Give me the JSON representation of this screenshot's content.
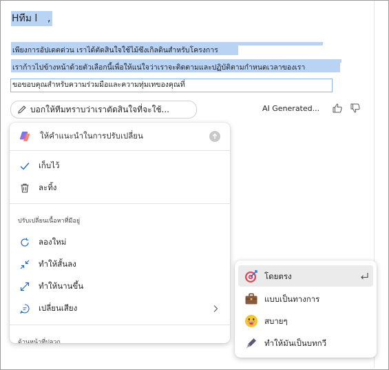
{
  "document": {
    "greeting_name": "Hทีม l",
    "greeting_comma": ",",
    "lines": [
      "เพียงการอัปเดตด่วน เราได้ตัดสินใจใช้ไม้ซึงเกิลดินสำหรับโครงการ",
      "เราก้าวไปข้างหน้าด้วยตัวเลือกนี้เพื่อให้แน่ใจว่าเราจะติดตามและปฏิบัติตามกำหนดเวลาของเรา",
      "ขอขอบคุณสำหรับความร่วมมือและความทุ่มเทของคุณที่"
    ]
  },
  "prompt_bar": {
    "placeholder": "บอกให้ทีมทราบว่าเราตัดสินใจที่จะใช้...",
    "ai_generated": "AI Generated...",
    "icons": {
      "edit": "pencil-icon",
      "like": "thumbs-up-icon",
      "dislike": "thumbs-down-icon"
    }
  },
  "menu": {
    "input_placeholder": "ให้คำแนะนำในการปรับเปลี่ยน",
    "keep": "เก็บไว้",
    "discard": "ละทิ้ง",
    "section_adjust": "ปรับเปลี่ยนเนื้อหาที่มีอยู่",
    "retry": "ลองใหม่",
    "shorten": "ทำให้สั้นลง",
    "lengthen": "ทำให้นานขึ้น",
    "change_tone": "เปลี่ยนเสียง",
    "section_bottom": "ด้านหน้าที่ปลวก"
  },
  "tone_submenu": {
    "items": [
      {
        "label": "โดยตรง",
        "icon": "target-icon",
        "selected": true
      },
      {
        "label": "แบบเป็นทางการ",
        "icon": "briefcase-icon",
        "selected": false
      },
      {
        "label": "สบายๆ",
        "icon": "grinning-face-icon",
        "selected": false
      },
      {
        "label": "ทำให้มันเป็นบทกวี",
        "icon": "fountain-pen-icon",
        "selected": false
      }
    ]
  },
  "colors": {
    "selection_highlight": "#b9d3f5",
    "copilot_gradient": [
      "#1a8cff",
      "#e3508f",
      "#f6a623"
    ]
  }
}
